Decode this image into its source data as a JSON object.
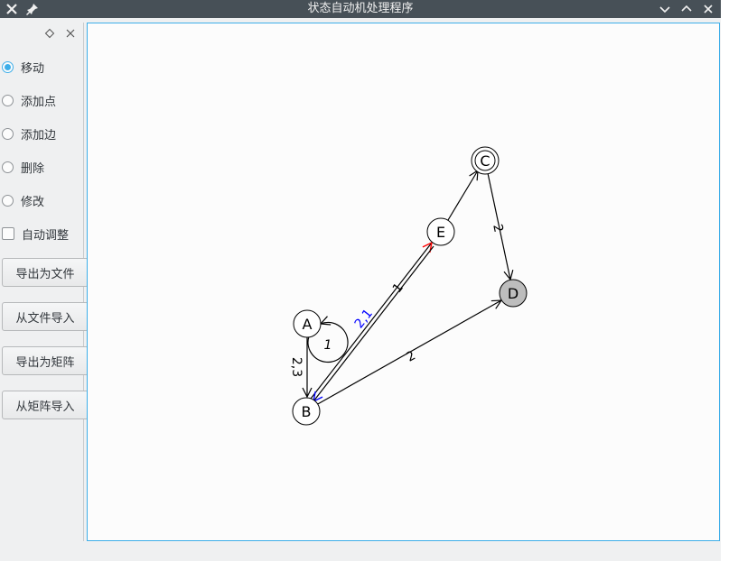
{
  "window": {
    "title": "状态自动机处理程序"
  },
  "sidebar": {
    "options": [
      {
        "label": "移动",
        "type": "radio",
        "checked": true
      },
      {
        "label": "添加点",
        "type": "radio",
        "checked": false
      },
      {
        "label": "添加边",
        "type": "radio",
        "checked": false
      },
      {
        "label": "删除",
        "type": "radio",
        "checked": false
      },
      {
        "label": "修改",
        "type": "radio",
        "checked": false
      },
      {
        "label": "自动调整",
        "type": "checkbox",
        "checked": false
      }
    ],
    "buttons": [
      {
        "label": "导出为文件"
      },
      {
        "label": "从文件导入"
      },
      {
        "label": "导出为矩阵"
      },
      {
        "label": "从矩阵导入"
      }
    ]
  },
  "graph": {
    "nodes": [
      {
        "id": "A",
        "label": "A",
        "state": "normal"
      },
      {
        "id": "B",
        "label": "B",
        "state": "normal"
      },
      {
        "id": "C",
        "label": "C",
        "state": "accepting"
      },
      {
        "id": "D",
        "label": "D",
        "state": "selected"
      },
      {
        "id": "E",
        "label": "E",
        "state": "normal"
      }
    ],
    "edges": [
      {
        "from": "A",
        "to": "A",
        "label": "1"
      },
      {
        "from": "A",
        "to": "B",
        "label": "2,3"
      },
      {
        "from": "B",
        "to": "E",
        "label": "1"
      },
      {
        "from": "E",
        "to": "B",
        "label": "2,1"
      },
      {
        "from": "B",
        "to": "D",
        "label": "2"
      },
      {
        "from": "E",
        "to": "C",
        "label": ""
      },
      {
        "from": "C",
        "to": "D",
        "label": "2"
      }
    ],
    "colors": {
      "node_fill": "#ffffff",
      "selected_fill": "#bdbdbd",
      "edge": "#000000",
      "reverse_edge": "#0000ff",
      "highlight_arrow": "#ff0000"
    }
  }
}
